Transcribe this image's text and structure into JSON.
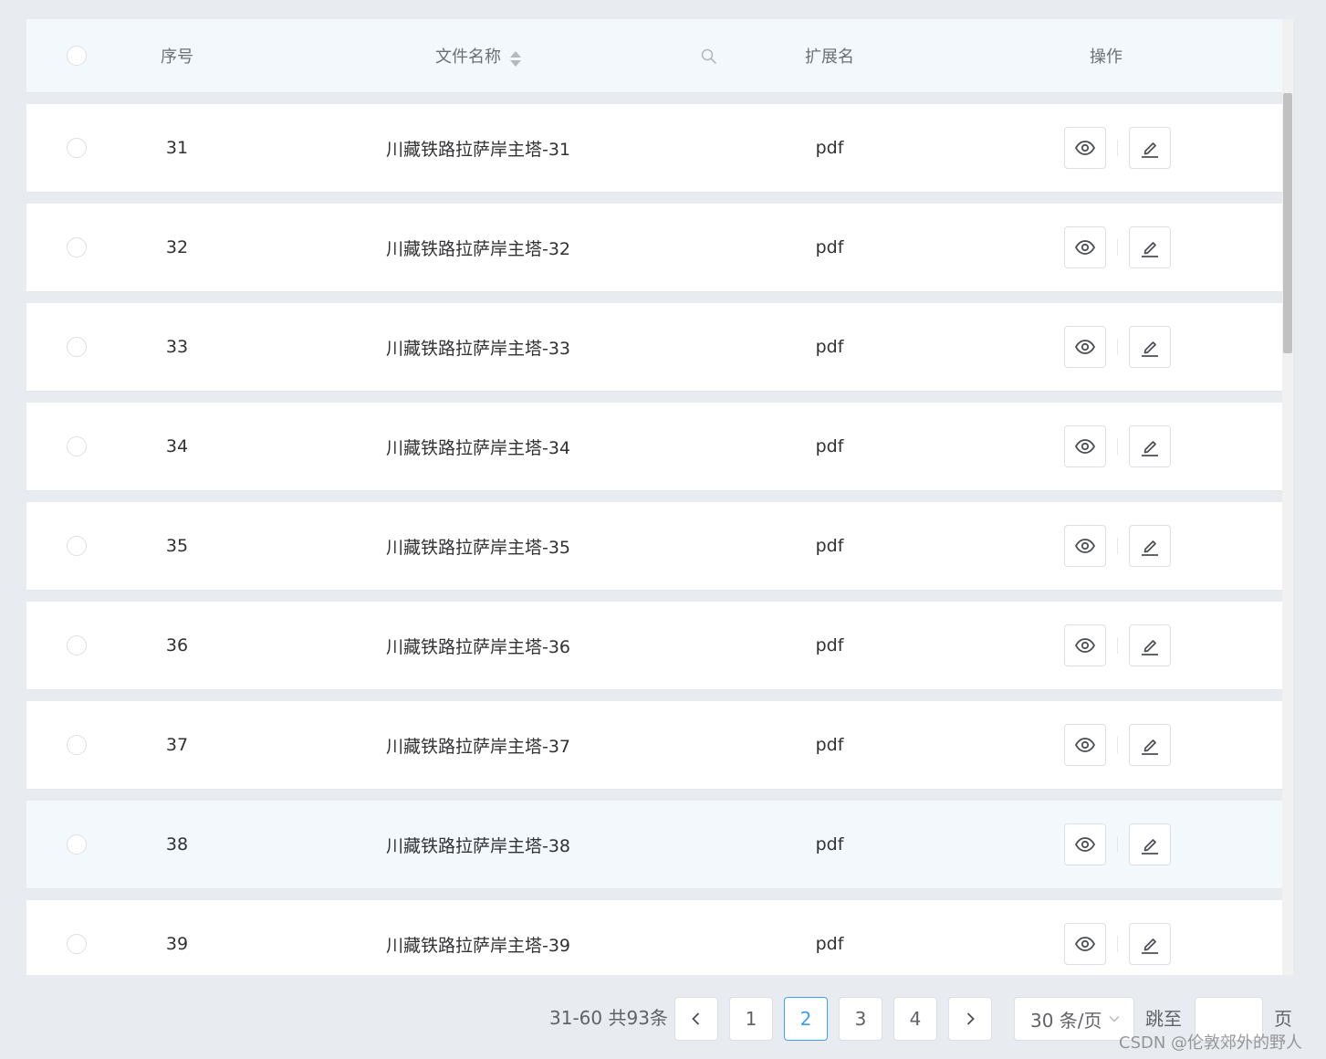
{
  "table": {
    "headers": {
      "index": "序号",
      "name": "文件名称",
      "ext": "扩展名",
      "ops": "操作"
    },
    "rows": [
      {
        "index": "31",
        "name": "川藏铁路拉萨岸主塔-31",
        "ext": "pdf"
      },
      {
        "index": "32",
        "name": "川藏铁路拉萨岸主塔-32",
        "ext": "pdf"
      },
      {
        "index": "33",
        "name": "川藏铁路拉萨岸主塔-33",
        "ext": "pdf"
      },
      {
        "index": "34",
        "name": "川藏铁路拉萨岸主塔-34",
        "ext": "pdf"
      },
      {
        "index": "35",
        "name": "川藏铁路拉萨岸主塔-35",
        "ext": "pdf"
      },
      {
        "index": "36",
        "name": "川藏铁路拉萨岸主塔-36",
        "ext": "pdf"
      },
      {
        "index": "37",
        "name": "川藏铁路拉萨岸主塔-37",
        "ext": "pdf"
      },
      {
        "index": "38",
        "name": "川藏铁路拉萨岸主塔-38",
        "ext": "pdf"
      },
      {
        "index": "39",
        "name": "川藏铁路拉萨岸主塔-39",
        "ext": "pdf"
      }
    ],
    "row_icons": {
      "view": "eye-icon",
      "edit": "edit-icon"
    }
  },
  "pagination": {
    "total_text": "31-60 共93条",
    "pages": [
      "1",
      "2",
      "3",
      "4"
    ],
    "current_page": "2",
    "page_size": "30 条/页",
    "jump_label": "跳至",
    "jump_value": "",
    "page_suffix": "页"
  },
  "watermark": "CSDN @伦敦郊外的野人",
  "colors": {
    "accent": "#409eff",
    "header_bg": "#f3f8fc",
    "page_bg": "#e8ecf0",
    "row_hover_bg": "#f3f8fc"
  }
}
